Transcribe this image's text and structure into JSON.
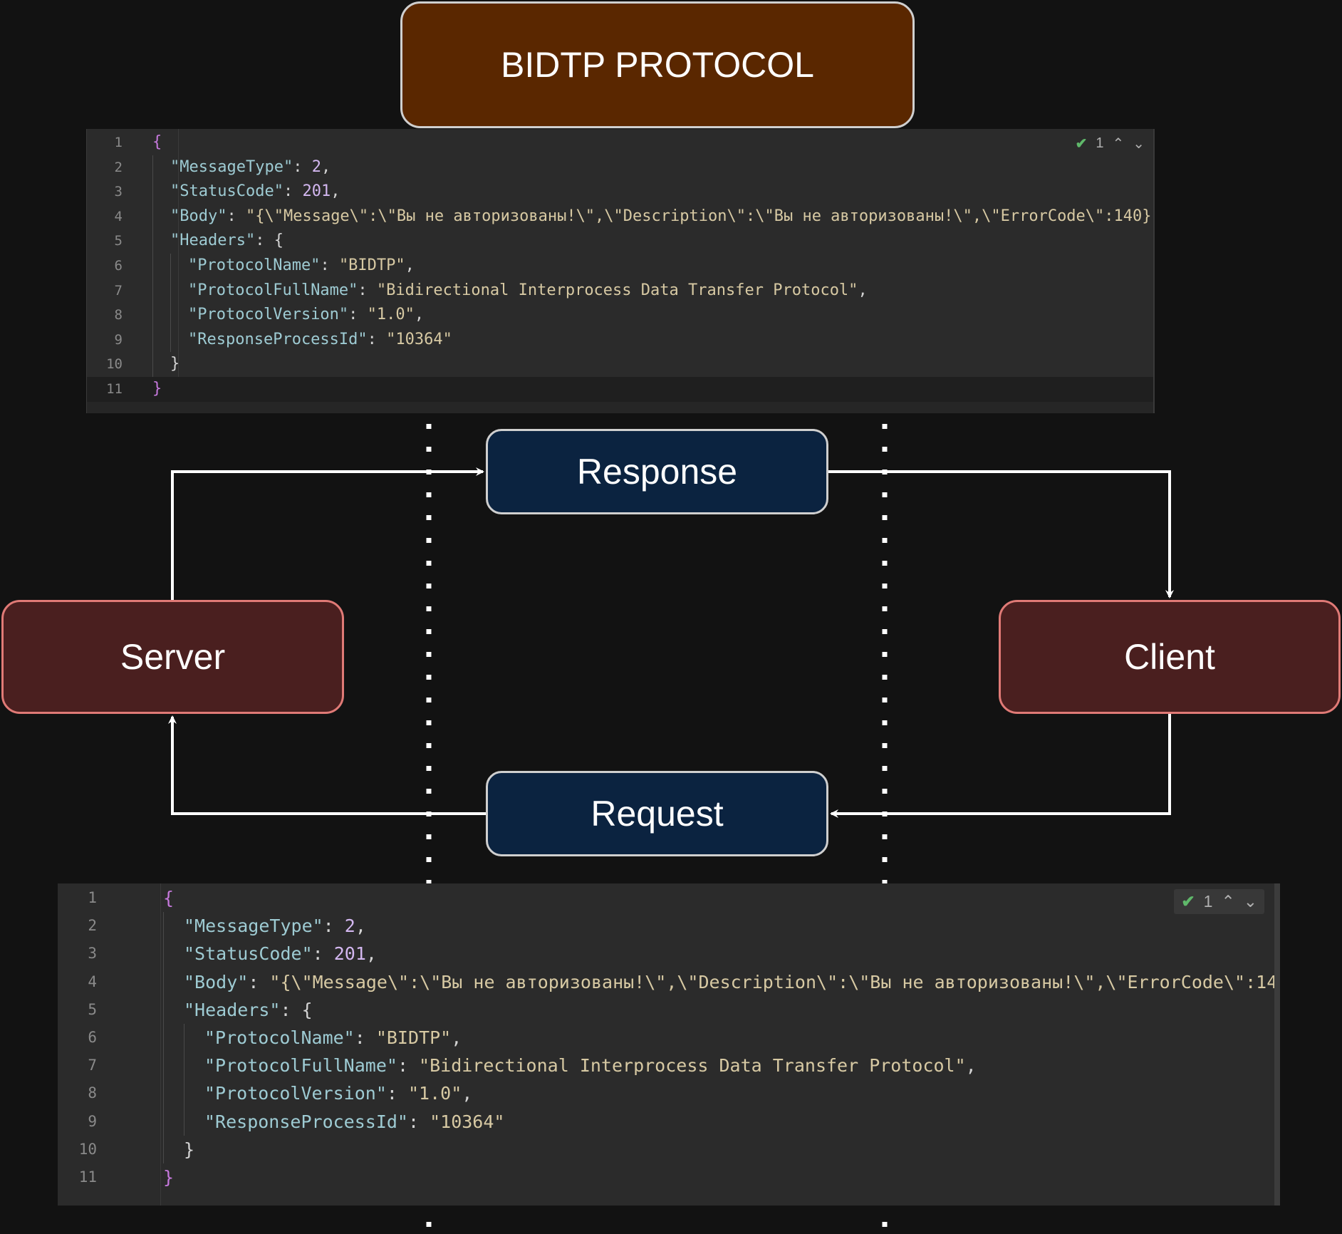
{
  "title": "BIDTP PROTOCOL",
  "nodes": {
    "response": "Response",
    "request": "Request",
    "server": "Server",
    "client": "Client"
  },
  "editor": {
    "inspection_count": "1",
    "check_icon": "check-icon",
    "up_icon": "chevron-up-icon",
    "down_icon": "chevron-down-icon",
    "line_numbers": [
      "1",
      "2",
      "3",
      "4",
      "5",
      "6",
      "7",
      "8",
      "9",
      "10",
      "11"
    ],
    "lines": [
      [
        {
          "t": "{",
          "c": "br"
        }
      ],
      [
        {
          "t": "\"MessageType\"",
          "c": "k"
        },
        {
          "t": ": ",
          "c": "p"
        },
        {
          "t": "2",
          "c": "n"
        },
        {
          "t": ",",
          "c": "p"
        }
      ],
      [
        {
          "t": "\"StatusCode\"",
          "c": "k"
        },
        {
          "t": ": ",
          "c": "p"
        },
        {
          "t": "201",
          "c": "n"
        },
        {
          "t": ",",
          "c": "p"
        }
      ],
      [
        {
          "t": "\"Body\"",
          "c": "k"
        },
        {
          "t": ": ",
          "c": "p"
        },
        {
          "t": "\"{\\\"Message\\\":\\\"Вы не авторизованы!\\\",\\\"Description\\\":\\\"Вы не авторизованы!\\\",\\\"ErrorCode\\\":140}\"",
          "c": "s"
        },
        {
          "t": ",",
          "c": "p"
        }
      ],
      [
        {
          "t": "\"Headers\"",
          "c": "k"
        },
        {
          "t": ": {",
          "c": "p"
        }
      ],
      [
        {
          "t": "\"ProtocolName\"",
          "c": "k"
        },
        {
          "t": ": ",
          "c": "p"
        },
        {
          "t": "\"BIDTP\"",
          "c": "s"
        },
        {
          "t": ",",
          "c": "p"
        }
      ],
      [
        {
          "t": "\"ProtocolFullName\"",
          "c": "k"
        },
        {
          "t": ": ",
          "c": "p"
        },
        {
          "t": "\"Bidirectional Interprocess Data Transfer Protocol\"",
          "c": "s"
        },
        {
          "t": ",",
          "c": "p"
        }
      ],
      [
        {
          "t": "\"ProtocolVersion\"",
          "c": "k"
        },
        {
          "t": ": ",
          "c": "p"
        },
        {
          "t": "\"1.0\"",
          "c": "s"
        },
        {
          "t": ",",
          "c": "p"
        }
      ],
      [
        {
          "t": "\"ResponseProcessId\"",
          "c": "k"
        },
        {
          "t": ": ",
          "c": "p"
        },
        {
          "t": "\"10364\"",
          "c": "s"
        }
      ],
      [
        {
          "t": "}",
          "c": "p"
        }
      ],
      [
        {
          "t": "}",
          "c": "br"
        }
      ]
    ],
    "indent_levels": [
      0,
      1,
      1,
      1,
      1,
      2,
      2,
      2,
      2,
      1,
      0
    ]
  },
  "colors": {
    "background": "#121212",
    "title_fill": "#5a2700",
    "message_fill": "#0b2340",
    "endpoint_fill": "#4a1f1f",
    "endpoint_border": "#e07a76",
    "connector": "#ffffff"
  }
}
